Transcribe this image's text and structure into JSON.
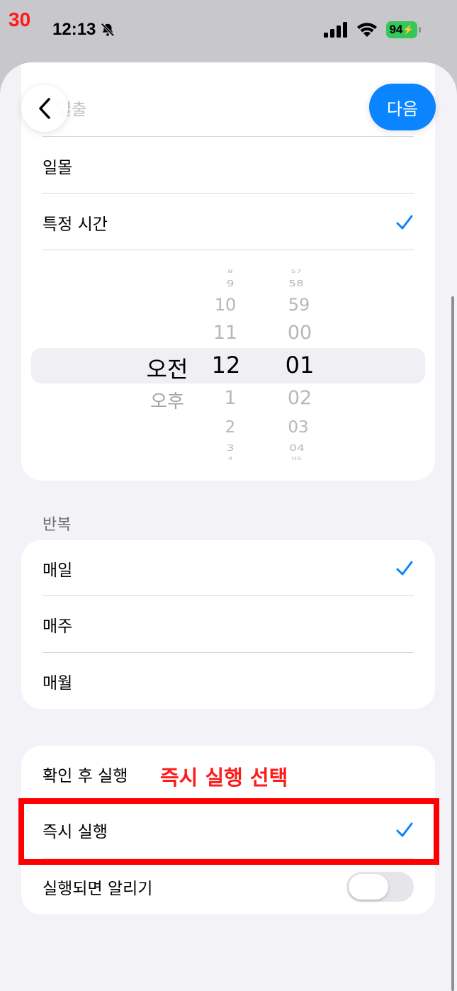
{
  "step_number": "30",
  "status_bar": {
    "time": "12:13",
    "battery": "94",
    "icons": [
      "bell-slash-icon",
      "cellular-signal-icon",
      "wifi-icon",
      "battery-charging-icon"
    ]
  },
  "header": {
    "back_icon": "chevron-left-icon",
    "partial_label": "일출",
    "next_label": "다음"
  },
  "time_section": {
    "options": [
      {
        "label": "일몰",
        "checked": false
      },
      {
        "label": "특정 시간",
        "checked": true
      }
    ],
    "picker": {
      "ampm": {
        "above": [],
        "selected": "오전",
        "below": [
          "오후"
        ]
      },
      "hour": {
        "above": [
          "8",
          "9",
          "10",
          "11"
        ],
        "selected": "12",
        "below": [
          "1",
          "2",
          "3",
          "4"
        ]
      },
      "minute": {
        "above": [
          "57",
          "58",
          "59",
          "00"
        ],
        "selected": "01",
        "below": [
          "02",
          "03",
          "04",
          "05"
        ]
      }
    }
  },
  "repeat_section": {
    "label": "반복",
    "options": [
      {
        "label": "매일",
        "checked": true
      },
      {
        "label": "매주",
        "checked": false
      },
      {
        "label": "매월",
        "checked": false
      }
    ]
  },
  "run_section": {
    "options": [
      {
        "label": "확인 후 실행",
        "checked": false
      },
      {
        "label": "즉시 실행",
        "checked": true
      }
    ],
    "notify": {
      "label": "실행되면 알리기",
      "enabled": false
    }
  },
  "annotation": "즉시 실행 선택",
  "colors": {
    "accent": "#0a84ff",
    "highlight": "#ff0000",
    "background": "#f2f2f7"
  }
}
